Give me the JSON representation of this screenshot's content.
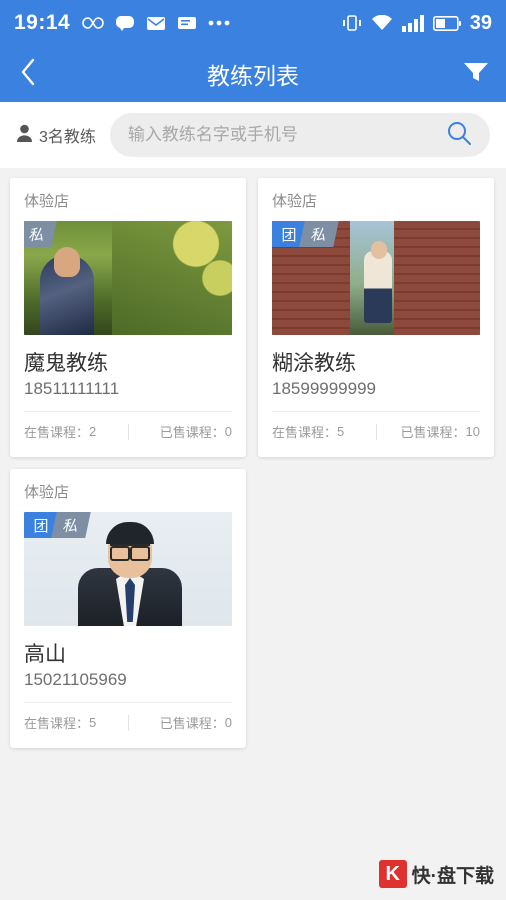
{
  "statusbar": {
    "time": "19:14",
    "battery_percent": "39",
    "icons": [
      "infinity-icon",
      "chat-bubble-icon",
      "mail-icon",
      "message-icon",
      "more-dots-icon",
      "vibrate-icon",
      "wifi-icon",
      "signal-icon",
      "battery-icon"
    ]
  },
  "titlebar": {
    "back_icon": "back-chevron-icon",
    "title": "教练列表",
    "filter_icon": "filter-funnel-icon"
  },
  "search": {
    "person_icon": "person-icon",
    "count_text": "3名教练",
    "placeholder": "输入教练名字或手机号",
    "value": "",
    "search_icon": "search-icon"
  },
  "labels": {
    "on_sale": "在售课程：",
    "sold": "已售课程："
  },
  "coaches": [
    {
      "store": "体验店",
      "badges": [
        "私"
      ],
      "name": "魔鬼教练",
      "phone": "18511111111",
      "on_sale": "2",
      "sold": "0",
      "photo": "ph1"
    },
    {
      "store": "体验店",
      "badges": [
        "团",
        "私"
      ],
      "name": "糊涂教练",
      "phone": "18599999999",
      "on_sale": "5",
      "sold": "10",
      "photo": "ph2"
    },
    {
      "store": "体验店",
      "badges": [
        "团",
        "私"
      ],
      "name": "高山",
      "phone": "15021105969",
      "on_sale": "5",
      "sold": "0",
      "photo": "ph3"
    }
  ],
  "watermark": {
    "mark": "K",
    "text": "快·盘下载"
  },
  "colors": {
    "brand": "#3b82e0",
    "badge_group": "#3b82e0",
    "badge_private": "#7e8fa3",
    "watermark_red": "#e03131"
  }
}
